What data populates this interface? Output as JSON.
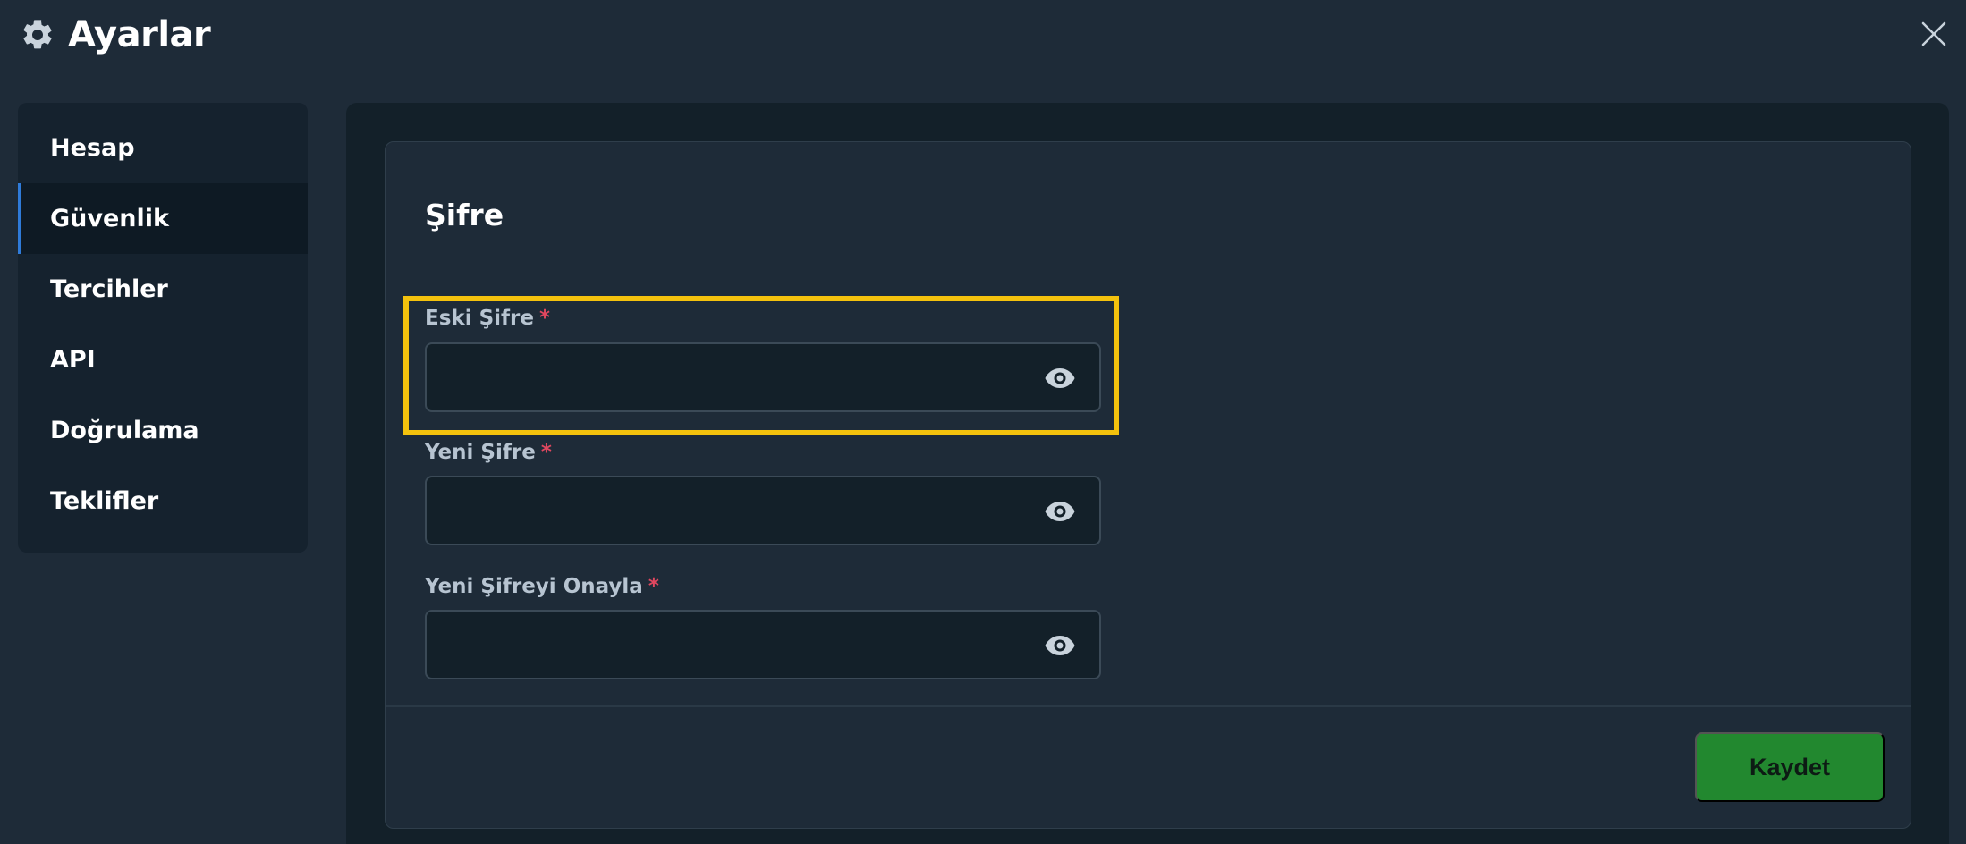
{
  "header": {
    "title": "Ayarlar",
    "icon": "gear-icon",
    "close_icon": "close-icon"
  },
  "sidebar": {
    "items": [
      {
        "label": "Hesap",
        "active": false
      },
      {
        "label": "Güvenlik",
        "active": true
      },
      {
        "label": "Tercihler",
        "active": false
      },
      {
        "label": "API",
        "active": false
      },
      {
        "label": "Doğrulama",
        "active": false
      },
      {
        "label": "Teklifler",
        "active": false
      }
    ]
  },
  "password_card": {
    "title": "Şifre",
    "required_mark": "*",
    "fields": [
      {
        "label": "Eski Şifre",
        "value": "",
        "icon": "eye-icon",
        "highlighted": true
      },
      {
        "label": "Yeni Şifre",
        "value": "",
        "icon": "eye-icon",
        "highlighted": false
      },
      {
        "label": "Yeni Şifreyi Onayla",
        "value": "",
        "icon": "eye-icon",
        "highlighted": false
      }
    ],
    "save_label": "Kaydet"
  },
  "colors": {
    "background": "#1e2b38",
    "panel": "#132029",
    "accent_active": "#2f7bd9",
    "highlight": "#f4c20d",
    "required": "#e0475f",
    "save_button": "#22882f"
  }
}
